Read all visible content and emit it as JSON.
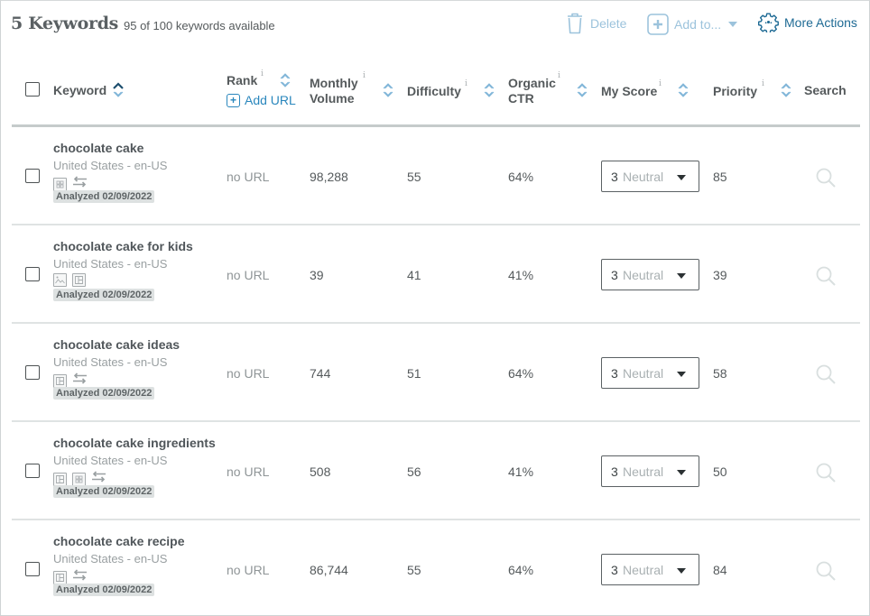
{
  "header": {
    "title": "5 Keywords",
    "availability": "95 of 100 keywords available"
  },
  "toolbar": {
    "delete_label": "Delete",
    "add_to_label": "Add to...",
    "more_actions_label": "More Actions",
    "colors": {
      "disabled": "#9cc3dc",
      "active": "#1e6a94",
      "link": "#2a87bd"
    }
  },
  "columns": {
    "keyword": "Keyword",
    "rank": "Rank",
    "add_url": "Add URL",
    "monthly_volume_1": "Monthly",
    "monthly_volume_2": "Volume",
    "difficulty": "Difficulty",
    "organic_ctr_1": "Organic",
    "organic_ctr_2": "CTR",
    "my_score": "My Score",
    "priority": "Priority",
    "search": "Search",
    "info_glyph": "i"
  },
  "rows": [
    {
      "keyword": "chocolate cake",
      "location": "United States - en-US",
      "icons": [
        "grid-icon",
        "swap-icon"
      ],
      "analyzed": "Analyzed 02/09/2022",
      "rank": "no URL",
      "volume": "98,288",
      "difficulty": "55",
      "ctr": "64%",
      "score_num": "3",
      "score_label": "Neutral",
      "priority": "85"
    },
    {
      "keyword": "chocolate cake for kids",
      "location": "United States - en-US",
      "icons": [
        "image-icon",
        "layout-icon"
      ],
      "analyzed": "Analyzed 02/09/2022",
      "rank": "no URL",
      "volume": "39",
      "difficulty": "41",
      "ctr": "41%",
      "score_num": "3",
      "score_label": "Neutral",
      "priority": "39"
    },
    {
      "keyword": "chocolate cake ideas",
      "location": "United States - en-US",
      "icons": [
        "layout-icon",
        "swap-icon"
      ],
      "analyzed": "Analyzed 02/09/2022",
      "rank": "no URL",
      "volume": "744",
      "difficulty": "51",
      "ctr": "64%",
      "score_num": "3",
      "score_label": "Neutral",
      "priority": "58"
    },
    {
      "keyword": "chocolate cake ingredients",
      "location": "United States - en-US",
      "icons": [
        "layout-icon",
        "grid-icon",
        "swap-icon"
      ],
      "analyzed": "Analyzed 02/09/2022",
      "rank": "no URL",
      "volume": "508",
      "difficulty": "56",
      "ctr": "41%",
      "score_num": "3",
      "score_label": "Neutral",
      "priority": "50"
    },
    {
      "keyword": "chocolate cake recipe",
      "location": "United States - en-US",
      "icons": [
        "layout-icon",
        "swap-icon"
      ],
      "analyzed": "Analyzed 02/09/2022",
      "rank": "no URL",
      "volume": "86,744",
      "difficulty": "55",
      "ctr": "64%",
      "score_num": "3",
      "score_label": "Neutral",
      "priority": "84"
    }
  ]
}
